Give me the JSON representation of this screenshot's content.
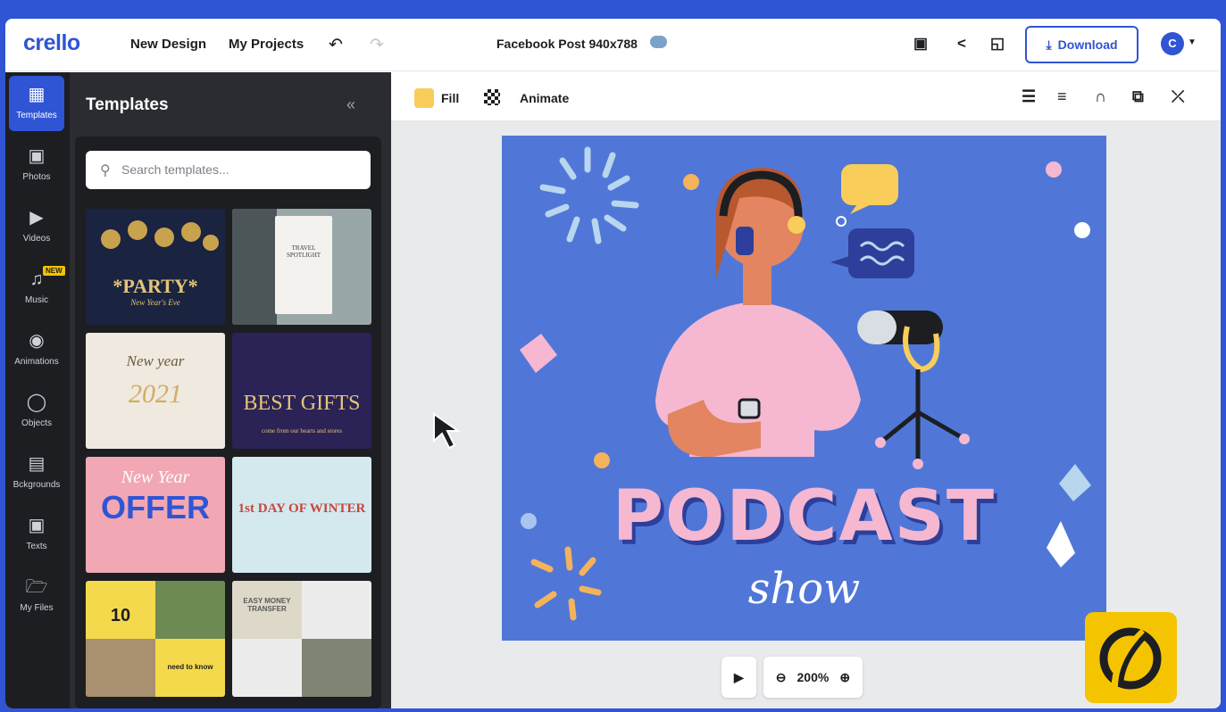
{
  "app": {
    "logo": "crello",
    "nav": {
      "new_design": "New Design",
      "my_projects": "My Projects"
    },
    "undo_icon": "undo-icon",
    "redo_icon": "redo-icon",
    "document_title": "Facebook Post 940x788",
    "download_label": "Download",
    "avatar_initial": "C"
  },
  "sidebar": {
    "items": [
      {
        "label": "Templates",
        "icon": "templates-icon",
        "active": true
      },
      {
        "label": "Photos",
        "icon": "photo-icon"
      },
      {
        "label": "Videos",
        "icon": "video-icon"
      },
      {
        "label": "Music",
        "icon": "music-icon",
        "badge": "NEW"
      },
      {
        "label": "Animations",
        "icon": "animation-icon"
      },
      {
        "label": "Objects",
        "icon": "objects-icon"
      },
      {
        "label": "Bckgrounds",
        "icon": "backgrounds-icon"
      },
      {
        "label": "Texts",
        "icon": "text-icon"
      },
      {
        "label": "My Files",
        "icon": "folder-icon"
      }
    ]
  },
  "templates_panel": {
    "title": "Templates",
    "search_placeholder": "Search templates...",
    "thumbnails": [
      {
        "title": "*PARTY*",
        "subtitle": "New Year's Eve"
      },
      {
        "title": "TRAVEL SPOTLIGHT"
      },
      {
        "title": "New year",
        "subtitle": "2021"
      },
      {
        "title": "BEST GIFTS",
        "subtitle": "come from our hearts and stores"
      },
      {
        "title": "New Year",
        "subtitle": "OFFER"
      },
      {
        "title": "1st DAY OF WINTER"
      },
      {
        "title": "10",
        "subtitle": "need to know"
      },
      {
        "title": "EASY MONEY TRANSFER"
      }
    ]
  },
  "edit_toolbar": {
    "fill_label": "Fill",
    "animate_label": "Animate",
    "fill_color": "#f9cd5a"
  },
  "canvas": {
    "title": "PODCAST",
    "subtitle": "show",
    "background": "#5077d8"
  },
  "playback": {
    "zoom": "200%"
  },
  "colors": {
    "brand_blue": "#2f55d4",
    "dark": "#1d1e22",
    "accent_yellow": "#f5c400"
  }
}
